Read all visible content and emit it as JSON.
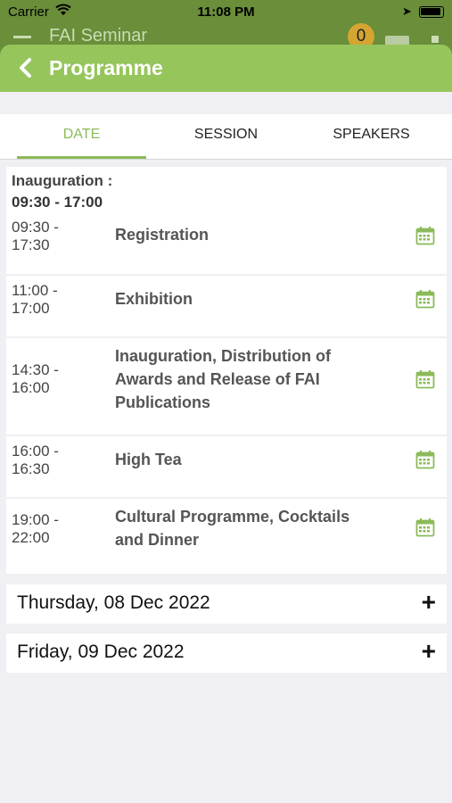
{
  "status_bar": {
    "carrier": "Carrier",
    "time": "11:08 PM"
  },
  "background_header": {
    "title": "FAI Seminar",
    "badge_count": "0"
  },
  "header": {
    "title": "Programme"
  },
  "tabs": [
    {
      "label": "DATE",
      "active": true
    },
    {
      "label": "SESSION",
      "active": false
    },
    {
      "label": "SPEAKERS",
      "active": false
    }
  ],
  "day_section": {
    "label": "Inauguration :",
    "range": "09:30 - 17:00",
    "events": [
      {
        "start": "09:30 -",
        "end": "17:30",
        "title_lines": [
          "Registration"
        ]
      },
      {
        "start": "11:00 -",
        "end": "17:00",
        "title_lines": [
          "Exhibition"
        ]
      },
      {
        "start": "14:30 -",
        "end": "16:00",
        "title_lines": [
          "Inauguration, Distribution of",
          "Awards and Release of FAI",
          "Publications"
        ]
      },
      {
        "start": "16:00 -",
        "end": "16:30",
        "title_lines": [
          "High Tea"
        ]
      },
      {
        "start": "19:00 -",
        "end": "22:00",
        "title_lines": [
          "Cultural Programme, Cocktails",
          "and Dinner"
        ]
      }
    ]
  },
  "collapsed_days": [
    {
      "label": "Thursday, 08 Dec 2022",
      "icon": "plus"
    },
    {
      "label": "Friday, 09 Dec 2022",
      "icon": "plus"
    }
  ],
  "colors": {
    "accent": "#8bbb59",
    "header_bar": "#96c55c",
    "background": "#efeff4"
  }
}
